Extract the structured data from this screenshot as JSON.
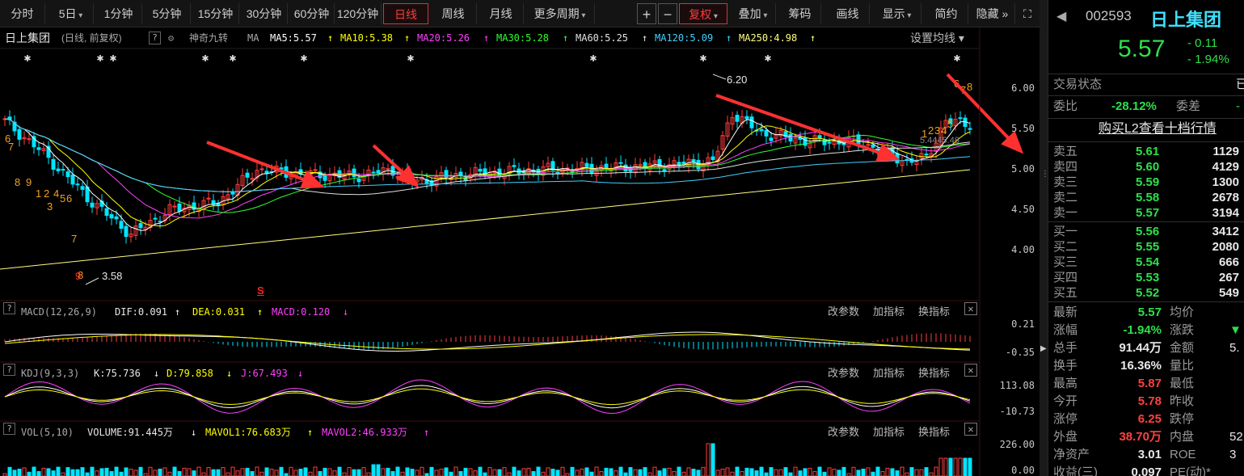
{
  "toolbar": {
    "periods": [
      "分时",
      "5日",
      "1分钟",
      "5分钟",
      "15分钟",
      "30分钟",
      "60分钟",
      "120分钟",
      "日线",
      "周线",
      "月线",
      "更多周期"
    ],
    "active_period": "日线",
    "plus": "+",
    "minus": "−",
    "fuquan": "复权",
    "overlay": "叠加",
    "chips": "筹码",
    "draw": "画线",
    "display": "显示",
    "simple": "简约",
    "hide": "隐藏",
    "expand_icon": "fullscreen-icon"
  },
  "legend": {
    "stock_name": "日上集团",
    "mode": "(日线, 前复权)",
    "help": "?",
    "indicator": "神奇九转",
    "ma_label": "MA",
    "ma5": "MA5:5.57",
    "ma10": "MA10:5.38",
    "ma20": "MA20:5.26",
    "ma30": "MA30:5.28",
    "ma60": "MA60:5.25",
    "ma120": "MA120:5.09",
    "ma250": "MA250:4.98",
    "arrow_up": "↑",
    "settings": "设置均线",
    "colors": {
      "ma5": "#ffffff",
      "ma10": "#ffff00",
      "ma20": "#ff40ff",
      "ma30": "#30ff30",
      "ma60": "#e0e0e0",
      "ma120": "#40d0ff",
      "ma250": "#ffff80"
    }
  },
  "main_axis": [
    "6.00",
    "5.50",
    "5.00",
    "4.50",
    "4.00"
  ],
  "annotations": {
    "high": "6.20",
    "low": "3.58",
    "low_count": "9",
    "mid_label": "5.4445.48",
    "s_marker": "S",
    "nine_left": [
      "6",
      "7",
      "8",
      "9",
      "1",
      "2",
      "3",
      "4",
      "5",
      "6",
      "7",
      "8"
    ],
    "nine_right": [
      "1",
      "2",
      "3",
      "4",
      "5",
      "6",
      "7",
      "8"
    ]
  },
  "macd": {
    "help": "?",
    "name": "MACD(12,26,9)",
    "dif": "DIF:0.091",
    "dea": "DEA:0.031",
    "macd": "MACD:0.120",
    "up": "↑",
    "down": "↓",
    "axis": [
      "0.21",
      "-0.35"
    ]
  },
  "kdj": {
    "help": "?",
    "name": "KDJ(9,3,3)",
    "k": "K:75.736",
    "d": "D:79.858",
    "j": "J:67.493",
    "down": "↓",
    "axis": [
      "113.08",
      "-10.73"
    ]
  },
  "vol": {
    "help": "?",
    "name": "VOL(5,10)",
    "volume": "VOLUME:91.445万",
    "mavol1": "MAVOL1:76.683万",
    "mavol2": "MAVOL2:46.933万",
    "up": "↑",
    "down": "↓",
    "axis": [
      "226.00",
      "0.00"
    ]
  },
  "panel_buttons": {
    "params": "改参数",
    "add": "加指标",
    "swap": "换指标",
    "close": "✕"
  },
  "quote": {
    "code": "002593",
    "name": "日上集团",
    "price": "5.57",
    "change": "- 0.11",
    "change_pct": "- 1.94%",
    "trade_status_label": "交易状态",
    "trade_status": "已",
    "weibi_label": "委比",
    "weibi": "-28.12%",
    "weicha_label": "委差",
    "weicha": "-",
    "l2_link": "购买L2查看十档行情",
    "sells": [
      {
        "label": "卖五",
        "price": "5.61",
        "vol": "1129"
      },
      {
        "label": "卖四",
        "price": "5.60",
        "vol": "4129"
      },
      {
        "label": "卖三",
        "price": "5.59",
        "vol": "1300"
      },
      {
        "label": "卖二",
        "price": "5.58",
        "vol": "2678"
      },
      {
        "label": "卖一",
        "price": "5.57",
        "vol": "3194"
      }
    ],
    "buys": [
      {
        "label": "买一",
        "price": "5.56",
        "vol": "3412"
      },
      {
        "label": "买二",
        "price": "5.55",
        "vol": "2080"
      },
      {
        "label": "买三",
        "price": "5.54",
        "vol": "666"
      },
      {
        "label": "买四",
        "price": "5.53",
        "vol": "267"
      },
      {
        "label": "买五",
        "price": "5.52",
        "vol": "549"
      }
    ],
    "stats": [
      {
        "l1": "最新",
        "v1": "5.57",
        "c1": "down",
        "l2": "均价",
        "v2": ""
      },
      {
        "l1": "涨幅",
        "v1": "-1.94%",
        "c1": "down",
        "l2": "涨跌",
        "v2": "▼"
      },
      {
        "l1": "总手",
        "v1": "91.44万",
        "c1": "white",
        "l2": "金额",
        "v2": "5."
      },
      {
        "l1": "换手",
        "v1": "16.36%",
        "c1": "white",
        "l2": "量比",
        "v2": ""
      },
      {
        "l1": "最高",
        "v1": "5.87",
        "c1": "up",
        "l2": "最低",
        "v2": ""
      },
      {
        "l1": "今开",
        "v1": "5.78",
        "c1": "up",
        "l2": "昨收",
        "v2": ""
      },
      {
        "l1": "涨停",
        "v1": "6.25",
        "c1": "up",
        "l2": "跌停",
        "v2": ""
      },
      {
        "l1": "外盘",
        "v1": "38.70万",
        "c1": "up",
        "l2": "内盘",
        "v2": "52."
      },
      {
        "l1": "净资产",
        "v1": "3.01",
        "c1": "white",
        "l2": "ROE",
        "v2": "3"
      },
      {
        "l1": "收益(三)",
        "v1": "0.097",
        "c1": "white",
        "l2": "PE(动)*",
        "v2": ""
      }
    ]
  }
}
